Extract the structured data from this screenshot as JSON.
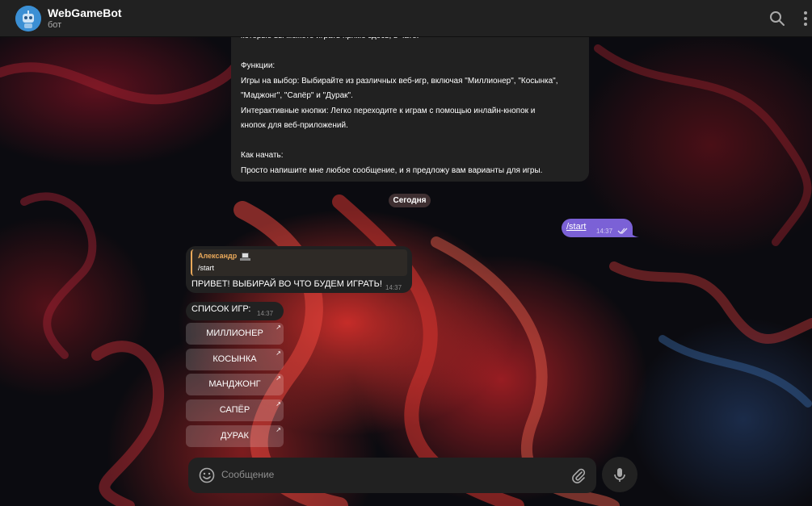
{
  "header": {
    "title": "WebGameBot",
    "subtitle": "бот"
  },
  "messages": {
    "bot_intro_lines": [
      "которые вы можете играть прямо здесь, в чате.",
      "",
      "Функции:",
      "Игры на выбор: Выбирайте из различных веб-игр, включая \"Миллионер\", \"Косынка\",",
      "\"Маджонг\", \"Сапёр\" и \"Дурак\".",
      "Интерактивные кнопки: Легко переходите к играм с помощью инлайн-кнопок и",
      "кнопок для веб-приложений.",
      "",
      "Как начать:",
      "Просто напишите мне любое сообщение, и я предложу вам варианты для игры."
    ],
    "date_separator": "Сегодня",
    "outgoing": {
      "text": "/start",
      "time": "14:37"
    },
    "reply": {
      "quote_author": "Александр",
      "quote_text": "/start",
      "text": "ПРИВЕТ! ВЫБИРАЙ ВО ЧТО БУДЕМ ИГРАТЬ!",
      "time": "14:37"
    },
    "game_list": {
      "text": "СПИСОК ИГР:",
      "time": "14:37",
      "buttons": [
        "МИЛЛИОНЕР",
        "КОСЫНКА",
        "МАНДЖОНГ",
        "САПЁР",
        "ДУРАК"
      ],
      "button_arrow": "↗"
    }
  },
  "composer": {
    "placeholder": "Сообщение"
  },
  "colors": {
    "accent_outgoing": "#7b61d6",
    "quote_name": "#e9a85a",
    "bubble_bg": "#212121"
  },
  "icons": [
    "bot-avatar-icon",
    "search-icon",
    "more-icon",
    "read-checks-icon",
    "emoji-icon",
    "attach-icon",
    "mic-icon"
  ]
}
